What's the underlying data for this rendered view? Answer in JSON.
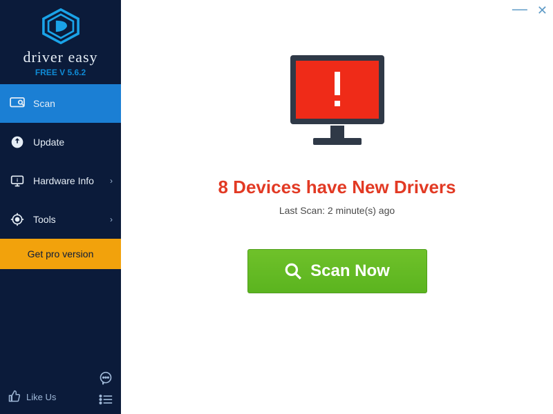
{
  "brand": {
    "name": "driver easy",
    "version": "FREE V 5.6.2"
  },
  "sidebar": {
    "items": [
      {
        "label": "Scan"
      },
      {
        "label": "Update"
      },
      {
        "label": "Hardware Info"
      },
      {
        "label": "Tools"
      }
    ],
    "pro_label": "Get pro version",
    "like_label": "Like Us"
  },
  "main": {
    "headline": "8 Devices have New Drivers",
    "last_scan": "Last Scan: 2 minute(s) ago",
    "scan_button": "Scan Now"
  }
}
